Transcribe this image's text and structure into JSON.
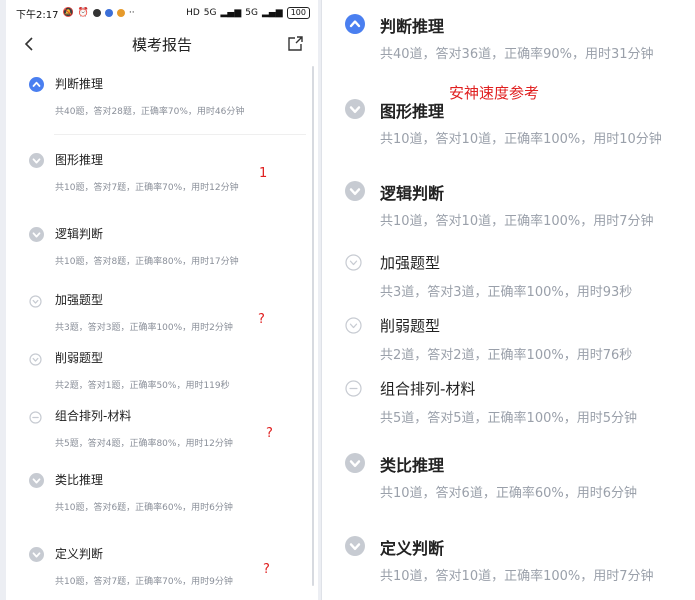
{
  "status_bar": {
    "time": "下午2:17",
    "net": "HD",
    "signal1": "5G",
    "signal2": "5G",
    "battery": "100"
  },
  "phone": {
    "title": "模考报告",
    "items": [
      {
        "state": "open",
        "title": "判断推理",
        "stat": "共40题，答对28题，正确率70%，用时46分钟"
      },
      {
        "state": "closed",
        "title": "图形推理",
        "stat": "共10题，答对7题，正确率70%，用时12分钟"
      },
      {
        "state": "closed",
        "title": "逻辑判断",
        "stat": "共10题，答对8题，正确率80%，用时17分钟"
      },
      {
        "state": "collapsed",
        "title": "加强题型",
        "stat": "共3题，答对3题，正确率100%，用时2分钟"
      },
      {
        "state": "collapsed",
        "title": "削弱题型",
        "stat": "共2题，答对1题，正确率50%，用时119秒"
      },
      {
        "state": "minus",
        "title": "组合排列-材料",
        "stat": "共5题，答对4题，正确率80%，用时12分钟"
      },
      {
        "state": "closed",
        "title": "类比推理",
        "stat": "共10题，答对6题，正确率60%，用时6分钟"
      },
      {
        "state": "closed",
        "title": "定义判断",
        "stat": "共10题，答对7题，正确率70%，用时9分钟"
      }
    ],
    "marks": {
      "number": "1",
      "question": "?"
    }
  },
  "right": {
    "annotation": "安神速度参考",
    "items": [
      {
        "state": "open",
        "title": "判断推理",
        "stat": "共40道，答对36道，正确率90%，用时31分钟"
      },
      {
        "state": "closed",
        "title": "图形推理",
        "stat": "共10道，答对10道，正确率100%，用时10分钟"
      },
      {
        "state": "closed",
        "title": "逻辑判断",
        "stat": "共10道，答对10道，正确率100%，用时7分钟"
      },
      {
        "state": "collapsed",
        "title": "加强题型",
        "stat": "共3道，答对3道，正确率100%，用时93秒"
      },
      {
        "state": "collapsed",
        "title": "削弱题型",
        "stat": "共2道，答对2道，正确率100%，用时76秒"
      },
      {
        "state": "minus",
        "title": "组合排列-材料",
        "stat": "共5道，答对5道，正确率100%，用时5分钟"
      },
      {
        "state": "closed",
        "title": "类比推理",
        "stat": "共10道，答对6道，正确率60%，用时6分钟"
      },
      {
        "state": "closed",
        "title": "定义判断",
        "stat": "共10道，答对10道，正确率100%，用时7分钟"
      }
    ]
  },
  "colors": {
    "accent": "#4a7ff0",
    "muted_icon": "#c7cbd2",
    "red_annotation": "#e02020"
  }
}
